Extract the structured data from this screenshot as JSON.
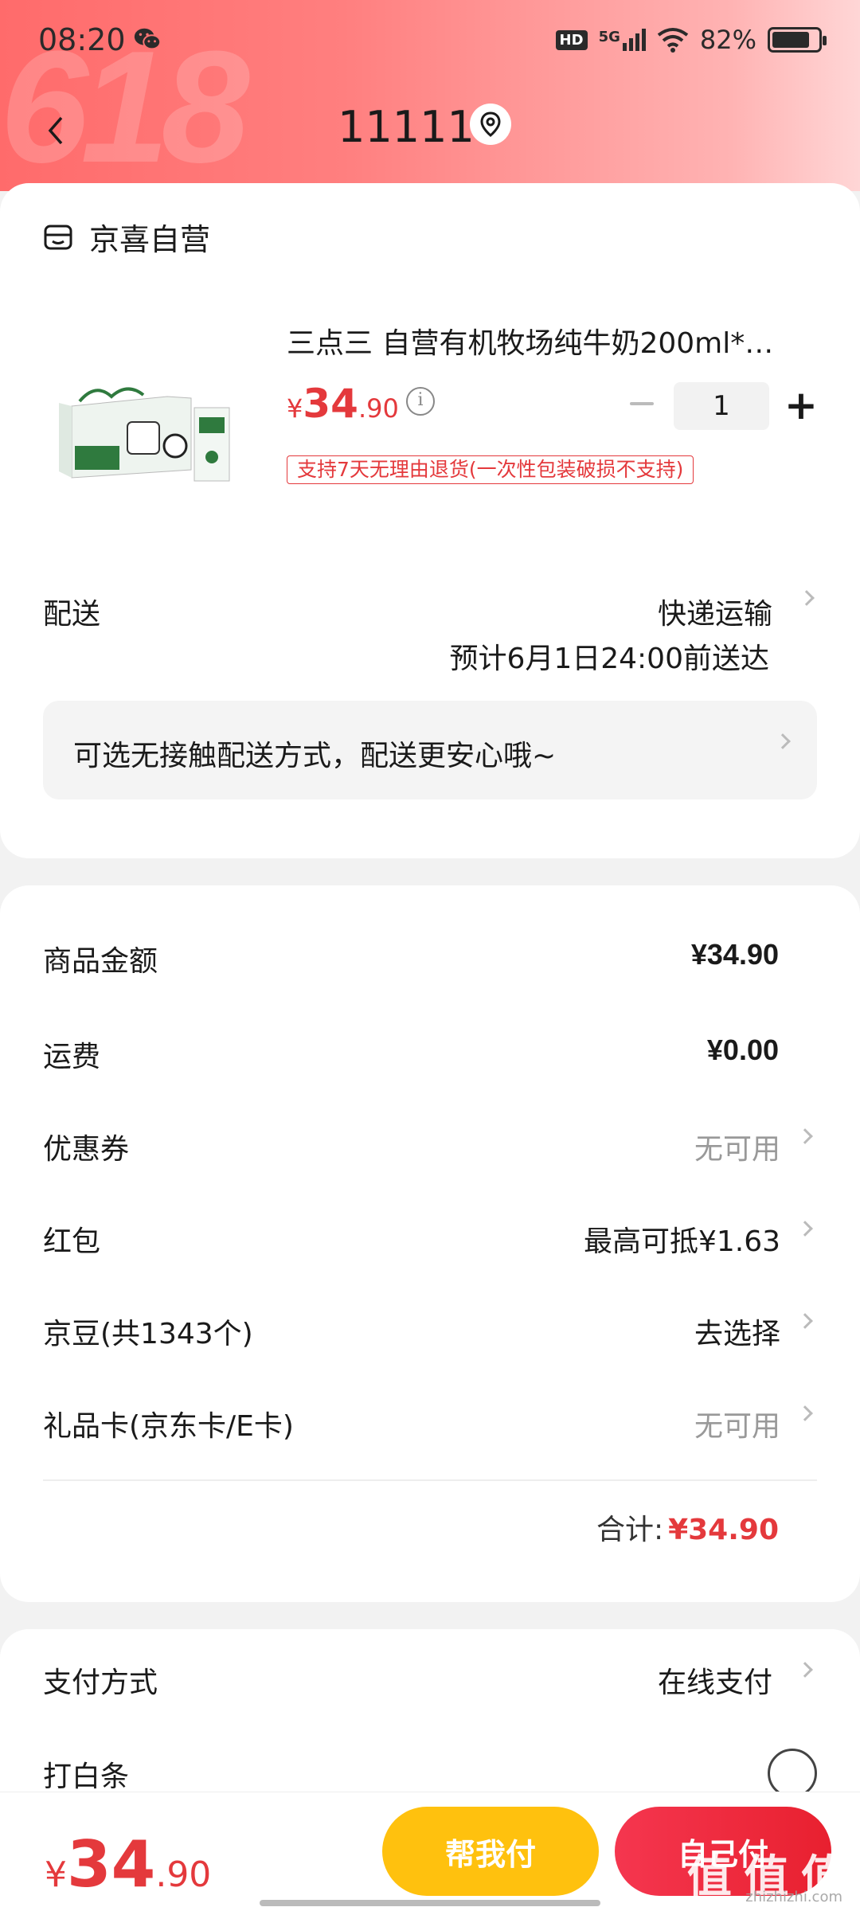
{
  "status": {
    "time": "08:20",
    "hd": "HD",
    "network": "5G",
    "battery": "82%",
    "battery_level": 0.82
  },
  "nav": {
    "title": "11111"
  },
  "shop": {
    "name": "京喜自营"
  },
  "product": {
    "title": "三点三 自营有机牧场纯牛奶200ml*…",
    "price_symbol": "¥",
    "price_int": "34",
    "price_dec": ".90",
    "quantity": "1",
    "return_policy": "支持7天无理由退货(一次性包装破损不支持)"
  },
  "delivery": {
    "label": "配送",
    "method": "快递运输",
    "eta": "预计6月1日24:00前送达",
    "contactless": "可选无接触配送方式，配送更安心哦~"
  },
  "summary": {
    "rows": [
      {
        "label": "商品金额",
        "value": "¥34.90"
      },
      {
        "label": "运费",
        "value": "¥0.00"
      },
      {
        "label": "优惠券",
        "value": "无可用"
      },
      {
        "label": "红包",
        "value": "最高可抵¥1.63"
      },
      {
        "label": "京豆(共1343个)",
        "value": "去选择"
      },
      {
        "label": "礼品卡(京东卡/E卡)",
        "value": "无可用"
      }
    ],
    "total_label": "合计:",
    "total_value": "¥34.90"
  },
  "payment": {
    "label": "支付方式",
    "value": "在线支付",
    "baitiao_label": "打白条"
  },
  "bottom": {
    "price_symbol": "¥",
    "price_int": "34",
    "price_dec": ".90",
    "friend_pay": "帮我付",
    "self_pay": "自己付",
    "watermark": "值 值 值",
    "watermark_sub": "zhizhizhi.com"
  },
  "colors": {
    "accent_red": "#e4393c",
    "header_red": "#ff6b6b",
    "friend_btn": "#ffc10e",
    "self_btn": "#e8202f"
  }
}
